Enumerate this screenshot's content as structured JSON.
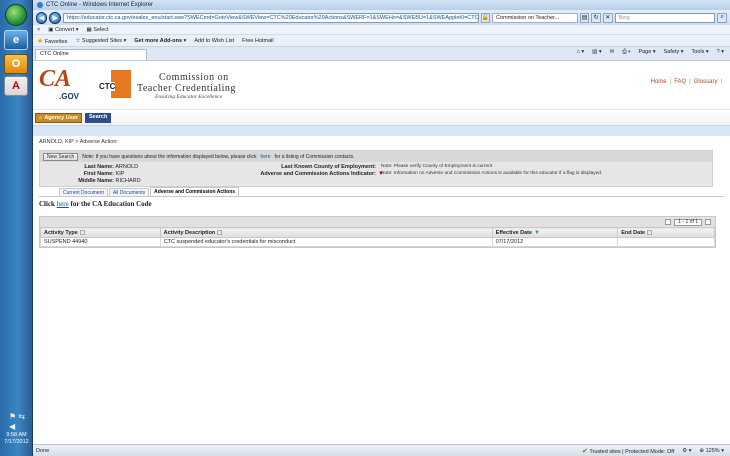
{
  "window": {
    "title": "CTC Online - Windows Internet Explorer",
    "url": "https://educator.ctc.ca.gov/esales_enu/start.swe?SWECmd=GotoView&SWEView=CTC%20Educator%20Actions&SWERF=1&SWEHo=&SWEBU=1&SWEApplet0=CTC%20Educator",
    "tab_nav_label": "Commission on Teacher...",
    "search_placeholder": "Bing"
  },
  "command_bar": {
    "convert": "Convert",
    "select": "Select"
  },
  "favorites_bar": {
    "favorites": "Favorites",
    "suggested_sites": "Suggested Sites",
    "get_addons": "Get more Add-ons",
    "wish_list": "Add to Wish List",
    "hotmail": "Free Hotmail"
  },
  "tab": {
    "label": "CTC Online"
  },
  "tools_bar": {
    "page": "Page",
    "safety": "Safety",
    "tools": "Tools"
  },
  "header": {
    "ca": "CA",
    "gov": ".GOV",
    "ctc": "CTC",
    "commission_line1": "Commission on",
    "commission_line2": "Teacher Credentialing",
    "tagline": "Ensuring Educator Excellence",
    "links": [
      "Home",
      "FAQ",
      "Glossary"
    ]
  },
  "agency_bar": {
    "agency_user": "Agency User",
    "search": "Search"
  },
  "breadcrumb": {
    "name": "ARNOLD, KIP",
    "sep": ">",
    "page": "Adverse Action:"
  },
  "notebar": {
    "new_search": "New Search",
    "note_prefix": "Note: If you have questions about the information displayed below, please click",
    "note_link": "here",
    "note_suffix": "for a listing of Commission contacts."
  },
  "educator": {
    "last_name_label": "Last Name:",
    "last_name": "ARNOLD",
    "first_name_label": "First Name:",
    "first_name": "KIP",
    "middle_name_label": "Middle Name:",
    "middle_name": "RICHARD",
    "county_label": "Last Known County of Employment:",
    "indicator_label": "Adverse and Commission Actions Indicator:",
    "note_county": "Note: Please verify County of Employment is current",
    "note_indicator": "Note: Information on Adverse and Commission Actions is available for this educator if a flag is displayed."
  },
  "subtabs": [
    "Current Document",
    "All Documents",
    "Adverse and Commission Actions"
  ],
  "education_code": {
    "prefix": "Click",
    "link": "here",
    "suffix": "for the CA Education Code"
  },
  "grid": {
    "pager": "1 - 1 of 1",
    "columns": [
      "Activity Type",
      "Activity Description",
      "Effective Date",
      "End Date"
    ],
    "rows": [
      {
        "activity_type": "SUSPEND 44940",
        "description": "CTC suspended educator's credentials for misconduct",
        "effective_date": "07/17/2012",
        "end_date": ""
      }
    ]
  },
  "statusbar": {
    "left": "Done",
    "zone": "Trusted sites | Protected Mode: Off",
    "zoom": "125%"
  },
  "taskbar": {
    "time": "9:58 AM",
    "date": "7/17/2012"
  }
}
